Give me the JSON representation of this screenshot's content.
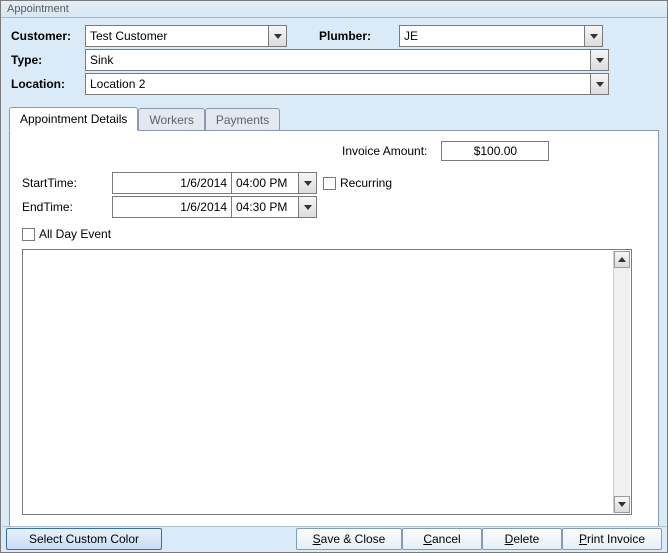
{
  "window": {
    "title": "Appointment"
  },
  "form": {
    "customer_label": "Customer:",
    "customer_value": "Test Customer",
    "plumber_label": "Plumber:",
    "plumber_value": "JE",
    "type_label": "Type:",
    "type_value": "Sink",
    "location_label": "Location:",
    "location_value": "Location 2"
  },
  "tabs": {
    "details": "Appointment Details",
    "workers": "Workers",
    "payments": "Payments"
  },
  "details": {
    "invoice_label": "Invoice Amount:",
    "invoice_value": "$100.00",
    "start_label": "StartTime:",
    "start_date": "1/6/2014",
    "start_time": "04:00 PM",
    "end_label": "EndTime:",
    "end_date": "1/6/2014",
    "end_time": "04:30 PM",
    "recurring_label": "Recurring",
    "allday_label": "All Day Event",
    "notes": ""
  },
  "buttons": {
    "color": "Select Custom Color",
    "save_full": "Save & Close",
    "save_u": "S",
    "save_rest": "ave & Close",
    "cancel_u": "C",
    "cancel_rest": "ancel",
    "delete_u": "D",
    "delete_rest": "elete",
    "print_u": "P",
    "print_rest": "rint Invoice"
  }
}
